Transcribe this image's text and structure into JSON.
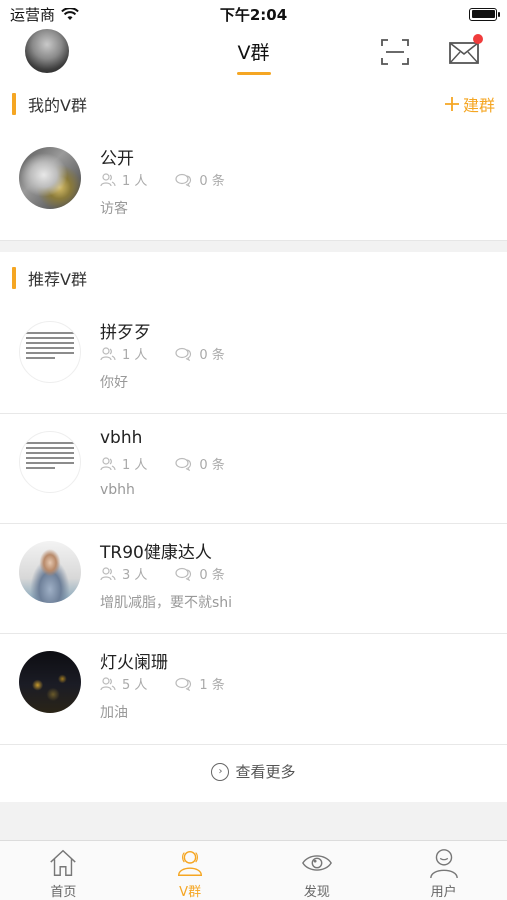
{
  "status_bar": {
    "carrier": "运营商",
    "time": "下午2:04"
  },
  "nav": {
    "title": "V群"
  },
  "my_groups": {
    "title": "我的V群",
    "action_label": "建群",
    "items": [
      {
        "name": "公开",
        "members": "1 人",
        "posts": "0 条",
        "desc": "访客"
      }
    ]
  },
  "recommended": {
    "title": "推荐V群",
    "items": [
      {
        "name": "拼歹歹",
        "members": "1 人",
        "posts": "0 条",
        "desc": "你好"
      },
      {
        "name": "vbhh",
        "members": "1 人",
        "posts": "0 条",
        "desc": "vbhh"
      },
      {
        "name": "TR90健康达人",
        "members": "3 人",
        "posts": "0 条",
        "desc": "增肌减脂，要不就shi"
      },
      {
        "name": "灯火阑珊",
        "members": "5 人",
        "posts": "1 条",
        "desc": "加油"
      }
    ],
    "more_label": "查看更多"
  },
  "tabs": [
    {
      "label": "首页",
      "icon": "home-icon"
    },
    {
      "label": "V群",
      "icon": "group-icon",
      "active": true
    },
    {
      "label": "发现",
      "icon": "eye-icon"
    },
    {
      "label": "用户",
      "icon": "user-icon"
    }
  ],
  "colors": {
    "accent": "#f5a623",
    "badge": "#f03c3c"
  }
}
